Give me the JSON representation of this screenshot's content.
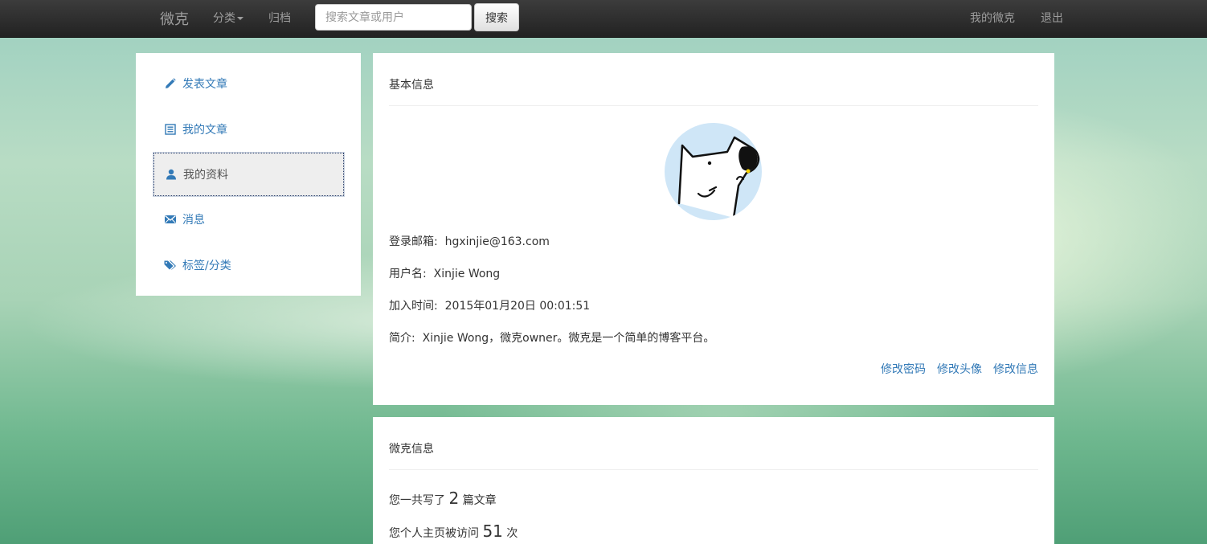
{
  "navbar": {
    "brand": "微克",
    "category": "分类",
    "archive": "归档",
    "search_placeholder": "搜索文章或用户",
    "search_button": "搜索",
    "my_weike": "我的微克",
    "logout": "退出"
  },
  "sidebar": {
    "items": [
      {
        "label": "发表文章",
        "icon": "pencil-icon"
      },
      {
        "label": "我的文章",
        "icon": "list-icon"
      },
      {
        "label": "我的资料",
        "icon": "user-icon",
        "active": true
      },
      {
        "label": "消息",
        "icon": "envelope-icon"
      },
      {
        "label": "标签/分类",
        "icon": "tags-icon"
      }
    ]
  },
  "profile": {
    "title": "基本信息",
    "email_label": "登录邮箱:",
    "email": "hgxinjie@163.com",
    "username_label": "用户名:",
    "username": "Xinjie Wong",
    "joined_label": "加入时间:",
    "joined": "2015年01月20日 00:01:51",
    "bio_label": "简介:",
    "bio": "Xinjie Wong，微克owner。微克是一个简单的博客平台。",
    "actions": {
      "change_password": "修改密码",
      "change_avatar": "修改头像",
      "change_info": "修改信息"
    }
  },
  "stats": {
    "title": "微克信息",
    "articles_prefix": "您一共写了",
    "articles_count": "2",
    "articles_suffix": "篇文章",
    "visits_prefix": "您个人主页被访问",
    "visits_count": "51",
    "visits_suffix": "次"
  },
  "colors": {
    "link": "#337ab7",
    "navbar": "#222222",
    "avatar_bg": "#cfe6f7"
  }
}
